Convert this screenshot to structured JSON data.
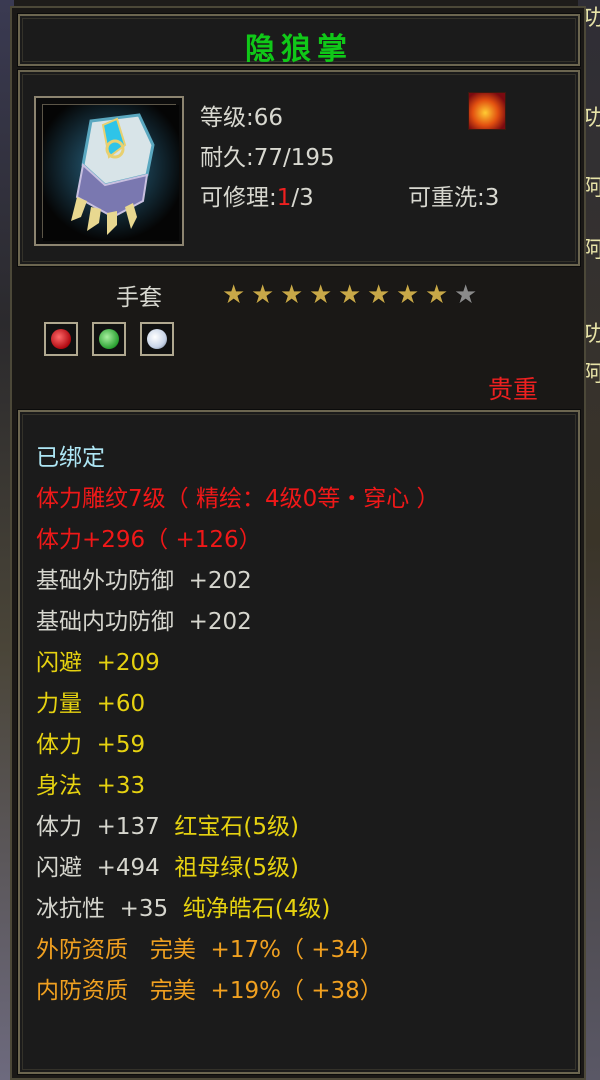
{
  "item": {
    "name": "隐狼掌",
    "level_text": "等级:66",
    "durability_text": "耐久:77/195",
    "repair_label": "可修理:",
    "repair_used": "1",
    "repair_total": "/3",
    "rewash_text": "可重洗:3",
    "type": "手套",
    "stars_filled": 8,
    "stars_total": 9,
    "rarity": "贵重"
  },
  "side_chars": [
    "功",
    "功",
    "阿",
    "阿",
    "功",
    "阿"
  ],
  "gem_icons": [
    "red-gem-icon",
    "green-gem-icon",
    "white-gem-icon"
  ],
  "stats": [
    {
      "text": "已绑定",
      "color": "#aee6f4"
    },
    {
      "text": "体力雕纹7级（ 精绘：4级0等・穿心 ）",
      "color": "#f01818"
    },
    {
      "text": "体力+296（ +126）",
      "color": "#f01818"
    },
    {
      "text": "基础外功防御  +202",
      "color": "#d6d6ce"
    },
    {
      "text": "基础内功防御  +202",
      "color": "#d6d6ce"
    },
    {
      "text": "闪避  +209",
      "color": "#e6d210"
    },
    {
      "text": "力量  +60",
      "color": "#e6d210"
    },
    {
      "text": "体力  +59",
      "color": "#e6d210"
    },
    {
      "text": "身法  +33",
      "color": "#e6d210"
    },
    {
      "text": "体力  +137  ",
      "extra": "红宝石(5级)",
      "color": "#d6d6ce",
      "extra_color": "#e6d210"
    },
    {
      "text": "闪避  +494  ",
      "extra": "祖母绿(5级)",
      "color": "#d6d6ce",
      "extra_color": "#e6d210"
    },
    {
      "text": "冰抗性  +35  ",
      "extra": "纯净皓石(4级)",
      "color": "#d6d6ce",
      "extra_color": "#e6d210"
    },
    {
      "text": "外防资质   完美  +17%（ +34）",
      "color": "#f0a020"
    },
    {
      "text": "内防资质   完美  +19%（ +38）",
      "color": "#f0a020"
    }
  ]
}
